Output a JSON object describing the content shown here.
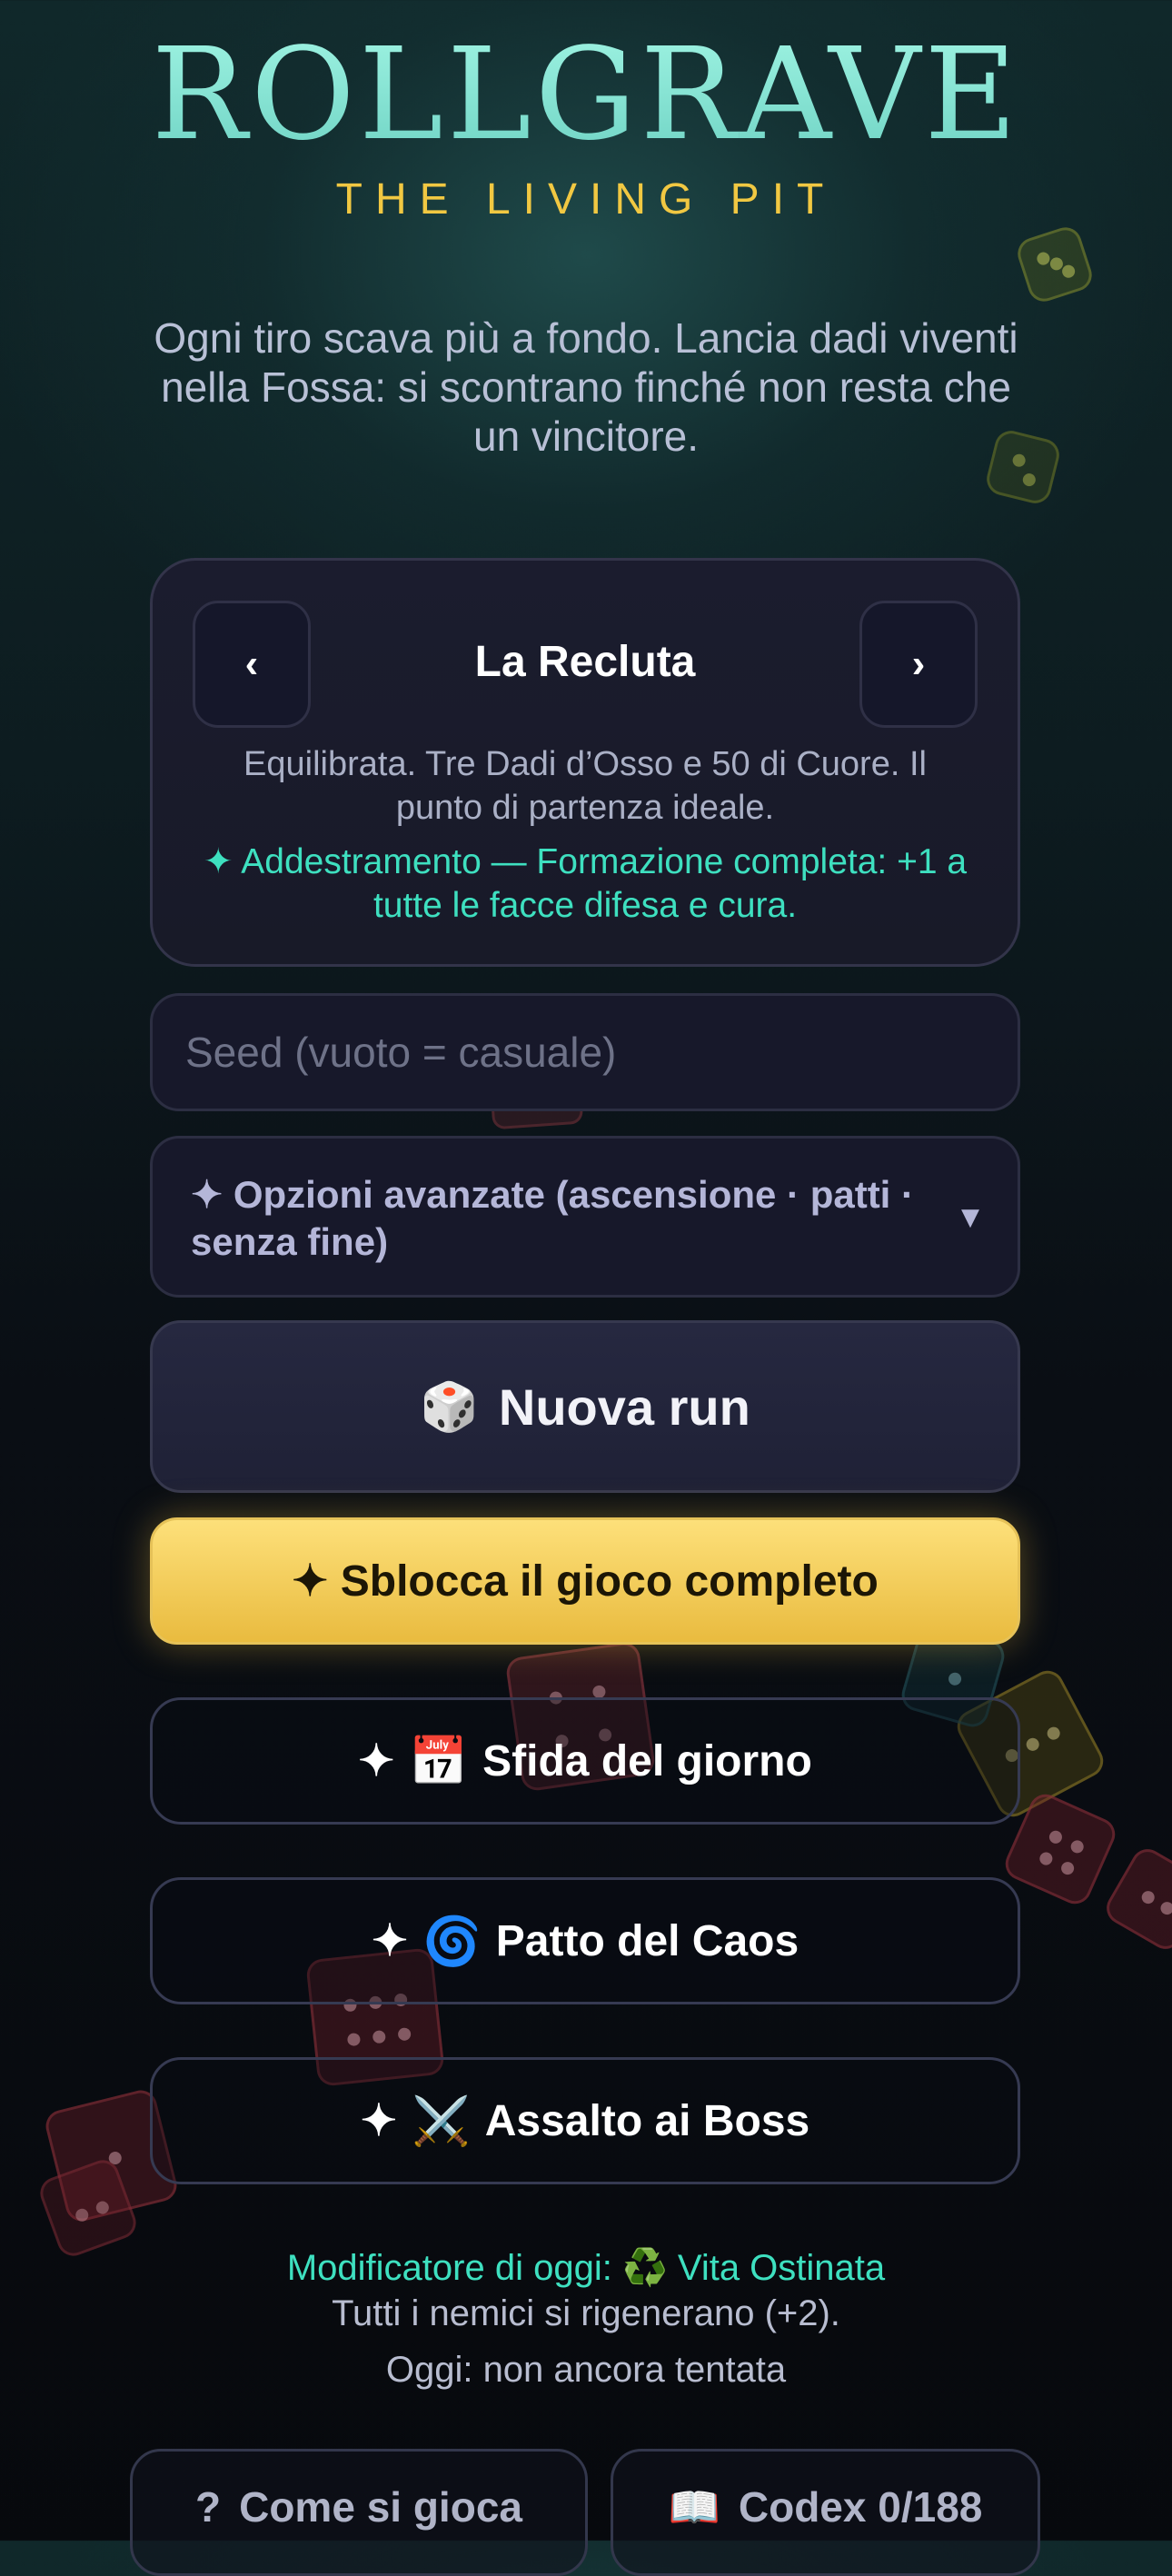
{
  "header": {
    "title": "ROLLGRAVE",
    "subtitle": "THE LIVING PIT",
    "intro": "Ogni tiro scava più a fondo. Lancia dadi viventi nella Fossa: si scontrano finché non resta che un vincitore."
  },
  "preset": {
    "prev_label": "‹",
    "next_label": "›",
    "name": "La Recluta",
    "description": "Equilibrata. Tre Dadi d’Osso e 50 di Cuore. Il punto di partenza ideale.",
    "bonus": "✦ Addestramento — Formazione completa: +1 a tutte le facce difesa e cura."
  },
  "seed": {
    "placeholder": "Seed (vuoto = casuale)",
    "value": ""
  },
  "advanced": {
    "label": "✦ Opzioni avanzate (ascensione · patti · senza fine)",
    "caret": "▼"
  },
  "actions": {
    "new_run_icon": "🎲",
    "new_run_label": "Nuova run",
    "unlock_label": "✦ Sblocca il gioco completo",
    "daily_prefix": "✦",
    "daily_icon": "📅",
    "daily_label": "Sfida del giorno",
    "chaos_prefix": "✦",
    "chaos_icon": "🌀",
    "chaos_label": "Patto del Caos",
    "boss_prefix": "✦",
    "boss_icon": "⚔️",
    "boss_label": "Assalto ai Boss"
  },
  "daily_modifier": {
    "title": "Modificatore di oggi: ♻️ Vita Ostinata",
    "description": "Tutti i nemici si rigenerano (+2).",
    "status": "Oggi: non ancora tentata"
  },
  "footer": {
    "howto_icon": "?",
    "howto_label": "Come si gioca",
    "codex_icon": "📖",
    "codex_label": "Codex 0/188"
  },
  "colors": {
    "title": "#8ee9d8",
    "subtitle": "#f1c842",
    "accent_teal": "#3ee0c0",
    "gold_button": "#f4cd5a"
  }
}
